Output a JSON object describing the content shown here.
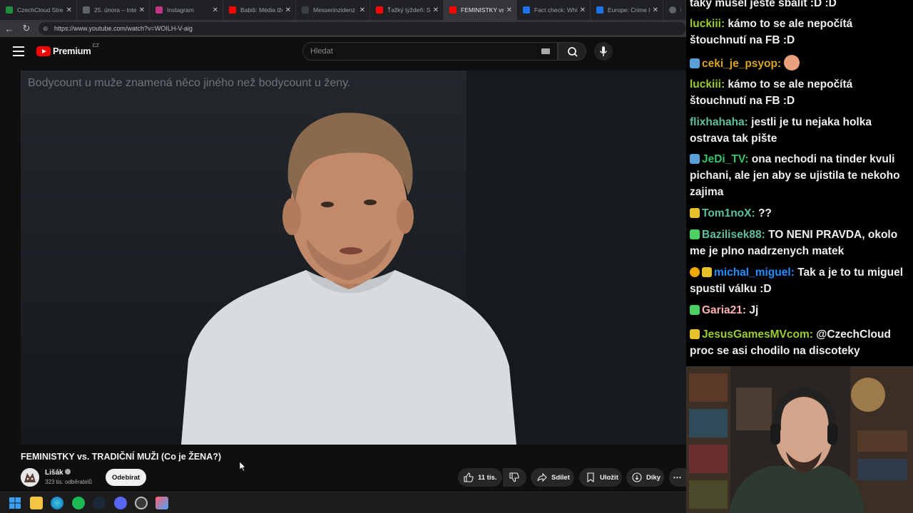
{
  "browser": {
    "tabs": [
      {
        "label": "CzechCloud Strea",
        "color": "#1e8e3e"
      },
      {
        "label": "25. února – Interv",
        "color": "#5f6368"
      },
      {
        "label": "Instagram",
        "color": "#c13584"
      },
      {
        "label": "Babiš: Média lžou",
        "color": "#ff0000"
      },
      {
        "label": "Messerinzidenz",
        "color": "#3c4043"
      },
      {
        "label": "Ťažký týždeň: Slov",
        "color": "#ff0000"
      },
      {
        "label": "FEMINISTKY vs. TR",
        "color": "#ff0000",
        "active": true
      },
      {
        "label": "Fact check: Which",
        "color": "#1a73e8"
      },
      {
        "label": "Europe: Crime Ind",
        "color": "#1a73e8"
      },
      {
        "label": "Ma",
        "color": "#5f6368"
      }
    ],
    "url": "https://www.youtube.com/watch?v=WOILH-V-aig"
  },
  "youtube": {
    "logo_text": "Premium",
    "logo_region": "CZ",
    "search_placeholder": "Hledat",
    "video": {
      "caption": "Bodycount u muže znamená něco jiného než bodycount u ženy.",
      "title": "FEMINISTKY vs. TRADIČNÍ MUŽI (Co je ŽENA?)"
    },
    "channel": {
      "name": "Lišák",
      "subscribers": "323 tis. odběratelů",
      "subscribe_label": "Odebírat"
    },
    "actions": {
      "likes": "11 tis.",
      "share": "Sdílet",
      "save": "Uložit",
      "thanks": "Díky"
    }
  },
  "chat": {
    "messages": [
      {
        "user": "",
        "text": "taky musel ještě sbalit :D :D",
        "color": "#efeff1"
      },
      {
        "user": "luckiii",
        "text": "kámo to se ale nepočítá štouchnutí na FB :D",
        "color": "#9acd32"
      },
      {
        "user": "ceki_je_psyop",
        "text": "",
        "color": "#daa520",
        "emote": true
      },
      {
        "user": "luckiii",
        "text": "kámo to se ale nepočítá štouchnutí na FB :D",
        "color": "#9acd32"
      },
      {
        "user": "flixhahaha",
        "text": "jestli je tu nejaka holka ostrava tak pište",
        "color": "#5f9ea0"
      },
      {
        "user": "JeDi_TV",
        "text": "ona nechodi na tinder kvuli pichani, ale jen aby se ujistila te nekoho zajima",
        "color": "#2e8b57"
      },
      {
        "user": "Tom1noX",
        "text": "??",
        "color": "#5f9ea0"
      },
      {
        "user": "Bazilisek88",
        "text": "TO NENI PRAVDA, okolo me je plno nadrzenych matek",
        "color": "#5f9ea0"
      },
      {
        "user": "michal_miguel",
        "text": "Tak a je to tu miguel spustil válku :D",
        "color": "#1e90ff"
      },
      {
        "user": "Garia21",
        "text": "Jj",
        "color": "#ff7f7f"
      },
      {
        "user": "JesusGamesMVcom",
        "text": "@CzechCloud proc se asi chodilo na discoteky",
        "color": "#9acd32"
      }
    ]
  }
}
